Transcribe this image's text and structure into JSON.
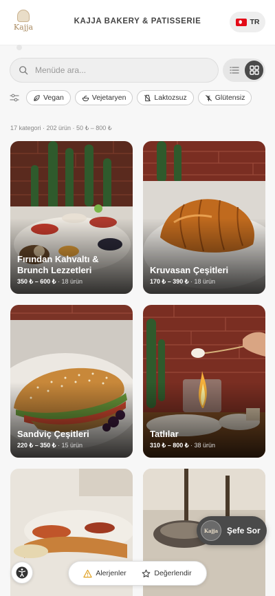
{
  "header": {
    "logo_text": "Kajja",
    "title": "KAJJA BAKERY & PATISSERIE",
    "lang_label": "TR",
    "lang_flag": "turkey-flag-icon"
  },
  "search": {
    "placeholder": "Menüde ara...",
    "value": ""
  },
  "view_toggle": {
    "options": [
      "list",
      "grid"
    ],
    "active": "grid"
  },
  "filters": [
    {
      "label": "Vegan",
      "icon": "leaf-icon"
    },
    {
      "label": "Vejetaryen",
      "icon": "salad-icon"
    },
    {
      "label": "Laktozsuz",
      "icon": "no-milk-icon"
    },
    {
      "label": "Glütensiz",
      "icon": "no-wheat-icon"
    }
  ],
  "summary": "17 kategori · 202 ürün · 50 ₺ – 800 ₺",
  "categories": [
    {
      "title": "Fırından Kahvaltı & Brunch Lezzetleri",
      "price": "350 ₺ – 600 ₺",
      "count": " · 18 ürün"
    },
    {
      "title": "Kruvasan Çeşitleri",
      "price": "170 ₺ – 390 ₺",
      "count": " · 18 ürün"
    },
    {
      "title": "Sandviç Çeşitleri",
      "price": "220 ₺ – 350 ₺",
      "count": " · 15 ürün"
    },
    {
      "title": "Tatlılar",
      "price": "310 ₺ – 800 ₺",
      "count": " · 38 ürün"
    },
    {
      "title": "",
      "price": "",
      "count": ""
    },
    {
      "title": "",
      "price": "",
      "count": ""
    }
  ],
  "chef_button": {
    "label": "Şefe Sor",
    "avatar_text": "Kajja"
  },
  "bottom_bar": {
    "allergens_label": "Alerjenler",
    "rate_label": "Değerlendir"
  },
  "colors": {
    "accent_dark": "#4a4a4a",
    "brand_gold": "#a8895e",
    "flag_red": "#e30a17"
  }
}
